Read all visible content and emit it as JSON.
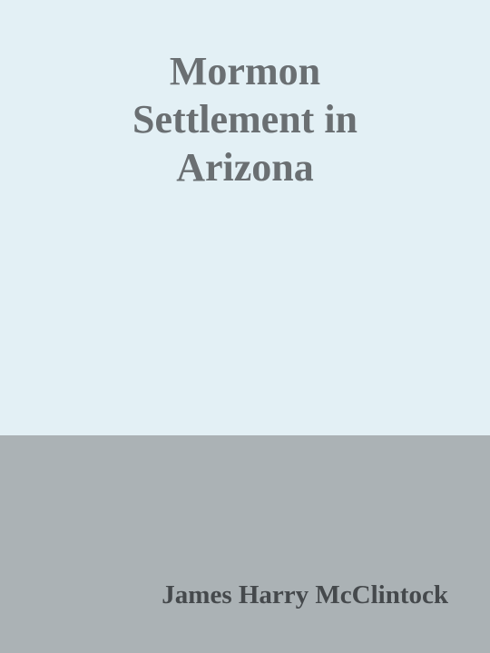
{
  "cover": {
    "title_lines": [
      "Mormon",
      "Settlement in",
      "Arizona"
    ],
    "author": "James Harry McClintock"
  },
  "colors": {
    "top_background": "#e3f0f5",
    "bottom_background": "#abb2b5",
    "title_text": "#6a6f72",
    "author_text": "#45494c"
  }
}
